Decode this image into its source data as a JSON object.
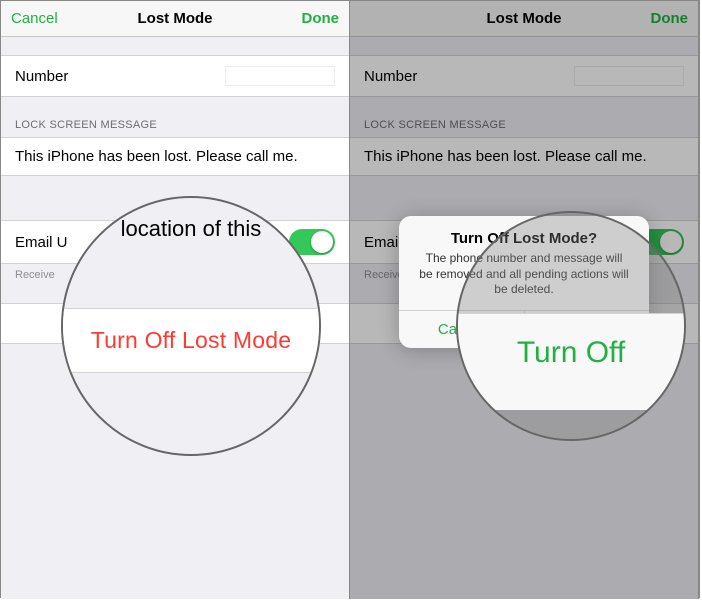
{
  "nav": {
    "cancel": "Cancel",
    "title": "Lost Mode",
    "done": "Done"
  },
  "sections": {
    "number_label": "Number",
    "lock_header": "LOCK SCREEN MESSAGE",
    "lock_message": "This iPhone has been lost. Please call me.",
    "email_updates_label": "Email Updates",
    "email_updates_prefix": "Email U",
    "receive_prefix": "Receive",
    "turn_off_label": "Turn Off Lost Mode"
  },
  "alert": {
    "title": "Turn Off Lost Mode?",
    "message_line1": "The phone number and message will",
    "message_line2": "be removed and all pending actions will",
    "message_line3": "be deleted.",
    "cancel": "Cancel",
    "confirm": "Turn Off"
  },
  "lens1": {
    "peek_text": "location of this",
    "action": "Turn Off Lost Mode"
  },
  "lens2": {
    "confirm": "Turn Off"
  }
}
